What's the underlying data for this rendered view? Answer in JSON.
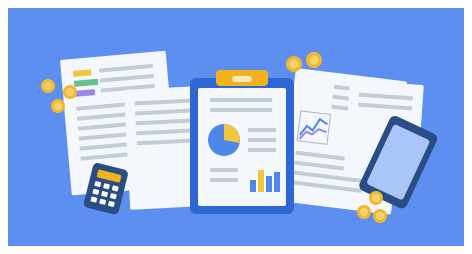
{
  "illustration": {
    "colors": {
      "background": "#5d8ff0",
      "page_border": "#ffffff",
      "paper": "#f4f7fb",
      "paper_shade": "#dfe6f0",
      "text_line": "#c3ccd9",
      "clipboard_board": "#2f66d6",
      "clipboard_clip": "#f2b21c",
      "pie_main": "#4f86ec",
      "pie_slice": "#f4c63a",
      "bar_blue": "#4f86ec",
      "bar_yellow": "#f4c63a",
      "coin": "#f1b732",
      "coin_inner": "#fbd56a",
      "calculator_body": "#2b4d86",
      "calculator_screen": "#f2b21c",
      "calculator_key": "#ffffff",
      "tablet_frame": "#2b4d86",
      "tablet_screen": "#a9c6f7",
      "sticky_yellow": "#f4c63a",
      "sticky_green": "#66c08b",
      "sticky_purple": "#9a86e6"
    },
    "icons": [
      "document-icon",
      "clipboard-icon",
      "pie-chart-icon",
      "bar-chart-icon",
      "line-chart-icon",
      "calculator-icon",
      "tablet-icon",
      "coin-icon"
    ]
  }
}
